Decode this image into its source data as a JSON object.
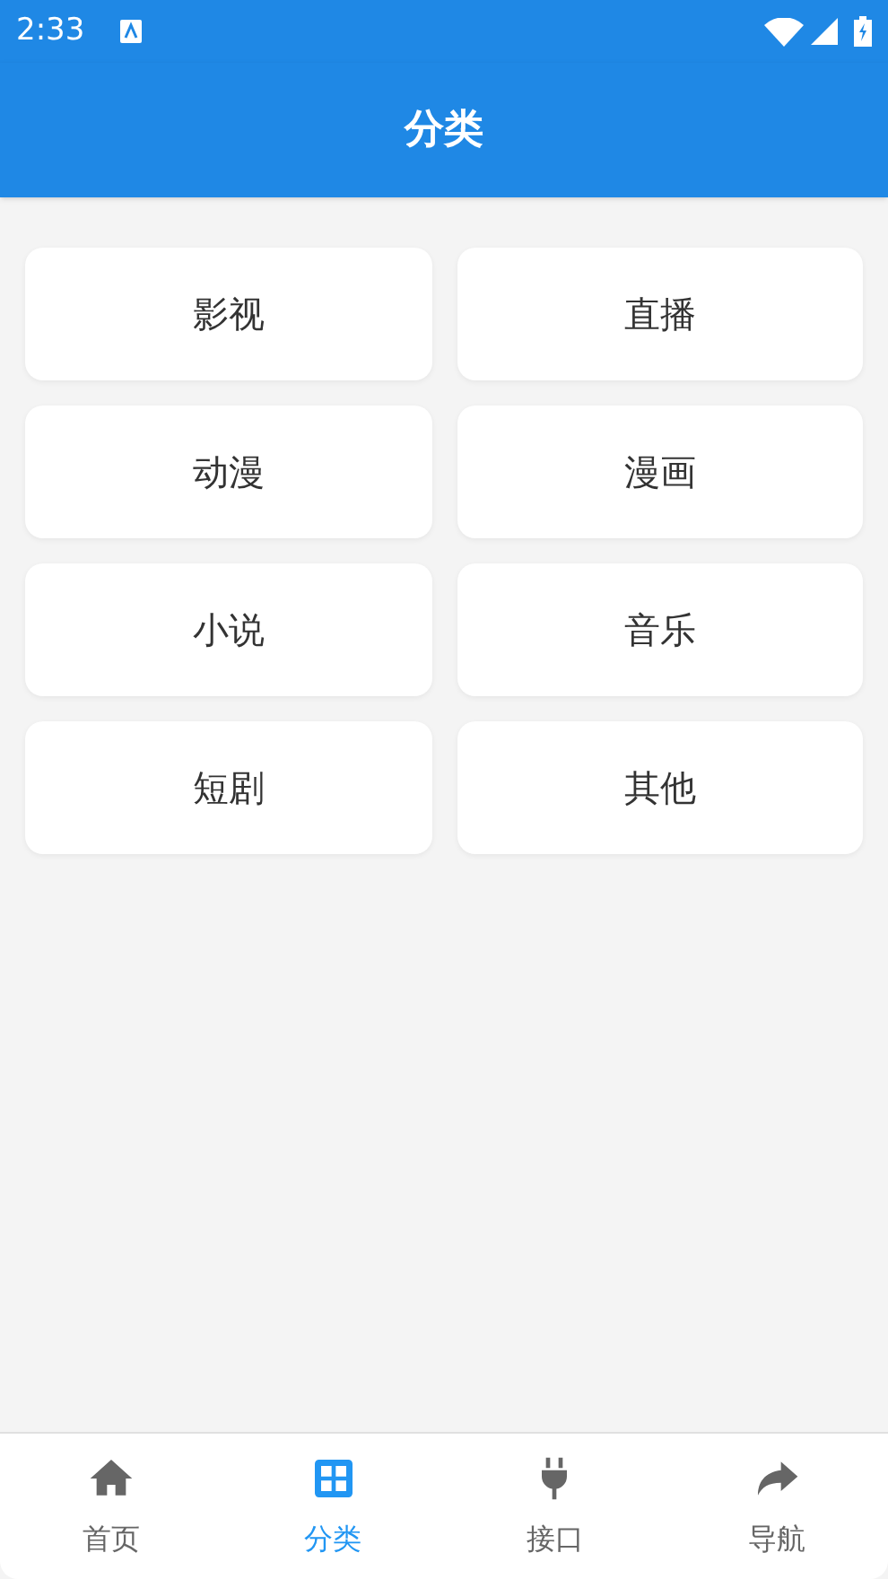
{
  "status_bar": {
    "time": "2:33"
  },
  "header": {
    "title": "分类"
  },
  "categories": [
    {
      "label": "影视"
    },
    {
      "label": "直播"
    },
    {
      "label": "动漫"
    },
    {
      "label": "漫画"
    },
    {
      "label": "小说"
    },
    {
      "label": "音乐"
    },
    {
      "label": "短剧"
    },
    {
      "label": "其他"
    }
  ],
  "nav": [
    {
      "label": "首页",
      "kind": "home",
      "selected": false
    },
    {
      "label": "分类",
      "kind": "grid",
      "selected": true
    },
    {
      "label": "接口",
      "kind": "plug",
      "selected": false
    },
    {
      "label": "导航",
      "kind": "share",
      "selected": false
    }
  ]
}
